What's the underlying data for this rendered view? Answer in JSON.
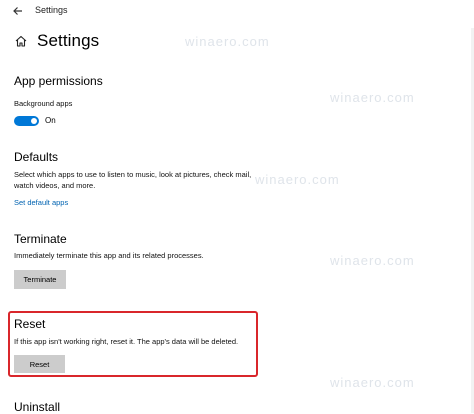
{
  "window": {
    "title": "Settings"
  },
  "header": {
    "title": "Settings"
  },
  "app_permissions": {
    "heading": "App permissions",
    "background_apps_label": "Background apps",
    "toggle_state": "On",
    "toggle_on": true
  },
  "defaults": {
    "heading": "Defaults",
    "description_line1": "Select which apps to use to listen to music, look at pictures, check mail,",
    "description_line2": "watch videos, and more.",
    "link": "Set default apps"
  },
  "terminate": {
    "heading": "Terminate",
    "description": "Immediately terminate this app and its related processes.",
    "button": "Terminate"
  },
  "reset": {
    "heading": "Reset",
    "description": "If this app isn't working right, reset it. The app's data will be deleted.",
    "button": "Reset"
  },
  "uninstall": {
    "heading": "Uninstall"
  },
  "watermark": "winaero.com",
  "colors": {
    "accent": "#0078d7",
    "highlight_border": "#d9262b",
    "link": "#0063b1",
    "button_bg": "#cccccc"
  }
}
